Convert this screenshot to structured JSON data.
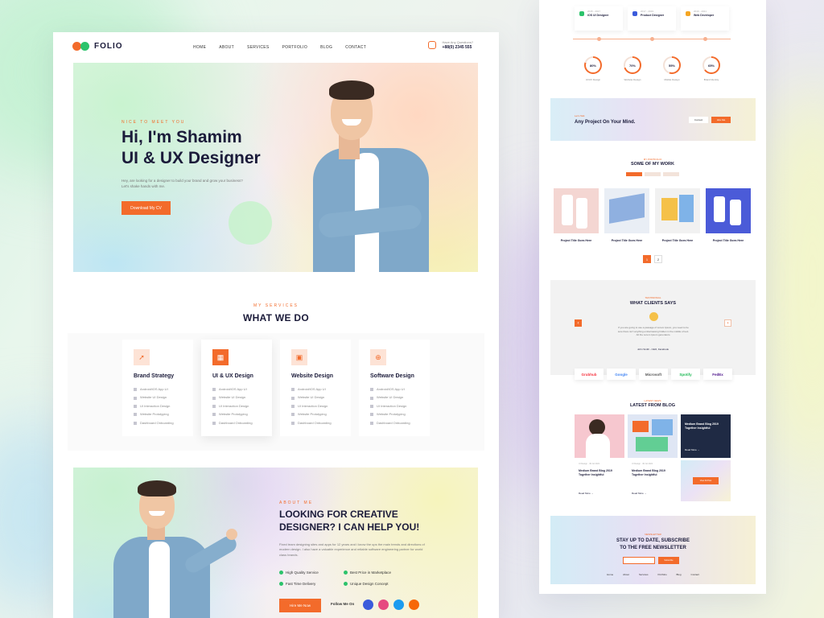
{
  "nav": {
    "logo": "FOLIO",
    "menu": [
      "HOME",
      "ABOUT",
      "SERVICES",
      "PORTFOLIO",
      "BLOG",
      "CONTACT"
    ],
    "phone_label": "Have Any Questions?",
    "phone_number": "+88(0) 2345 555"
  },
  "hero": {
    "subtitle": "NICE TO MEET YOU",
    "title_line1": "Hi, I'm Shamim",
    "title_line2": "UI & UX Designer",
    "description": "Hey, are looking for a designer to build your brand and grow your business? Let's shake hands with me.",
    "button": "Download My CV"
  },
  "services": {
    "subtitle": "MY SERVICES",
    "title": "WHAT WE DO",
    "items": [
      {
        "title": "Brand Strategy",
        "icon": "rocket-icon",
        "active": false,
        "features": [
          "Android/iOS App UI",
          "Website UI Design",
          "UI Interaction Design",
          "Website Prototyping",
          "Dashboard Onboarding"
        ]
      },
      {
        "title": "UI & UX Design",
        "icon": "layout-icon",
        "active": true,
        "features": [
          "Android/iOS App UI",
          "Website UI Design",
          "UI Interaction Design",
          "Website Prototyping",
          "Dashboard Onboarding"
        ]
      },
      {
        "title": "Website Design",
        "icon": "browser-icon",
        "active": false,
        "features": [
          "Android/iOS App UI",
          "Website UI Design",
          "UI Interaction Design",
          "Website Prototyping",
          "Dashboard Onboarding"
        ]
      },
      {
        "title": "Software Design",
        "icon": "globe-icon",
        "active": false,
        "features": [
          "Android/iOS App UI",
          "Website UI Design",
          "UI Interaction Design",
          "Website Prototyping",
          "Dashboard Onboarding"
        ]
      }
    ]
  },
  "about": {
    "subtitle": "ABOUT ME",
    "title_line1": "LOOKING FOR CREATIVE",
    "title_line2": "DESIGNER? I CAN HELP YOU!",
    "description": "Fixed team designing sites and apps for 12 years and i know the ups the main trends and directions of modern design. I also have a valuable experience and reliable software engineering partner for world class brands.",
    "features": [
      "High Quality Service",
      "Best Price in Marketplace",
      "Fast Time Delivery",
      "Unique Design Concept"
    ],
    "button": "Hire Me Now",
    "follow_label": "Follow Me On",
    "socials": [
      {
        "name": "facebook-icon",
        "color": "#3b5bdb"
      },
      {
        "name": "dribbble-icon",
        "color": "#e64980"
      },
      {
        "name": "twitter-icon",
        "color": "#1c9bef"
      },
      {
        "name": "instagram-icon",
        "color": "#f76707"
      }
    ]
  },
  "right": {
    "experience": [
      {
        "year": "2015 - 2017",
        "role": "iOS UI Designer",
        "color": "#2cc36b"
      },
      {
        "year": "2017 - 2019",
        "role": "Product Designer",
        "color": "#3b5bdb"
      },
      {
        "year": "2019 - 2021",
        "role": "Web Developer",
        "color": "#f5a623"
      }
    ],
    "skills": [
      {
        "pct": "80%",
        "label": "UI/UX Design",
        "value": 80
      },
      {
        "pct": "70%",
        "label": "Website Design",
        "value": 70
      },
      {
        "pct": "55%",
        "label": "Mobile Design",
        "value": 55
      },
      {
        "pct": "65%",
        "label": "Brand Identity",
        "value": 65
      }
    ],
    "cta": {
      "subtitle": "Let's Talk",
      "text": "Any Project On Your Mind.",
      "btn1": "Contact",
      "btn2": "Hire Me"
    },
    "work": {
      "subtitle": "MY PORTFOLIO",
      "title": "SOME OF MY WORK",
      "projects": [
        "Project Title Goes Here",
        "Project Title Goes Here",
        "Project Title Goes Here",
        "Project Title Goes Here"
      ],
      "pages": [
        "1",
        "2"
      ]
    },
    "testimonial": {
      "subtitle": "TESTIMONIAL",
      "title": "WHAT CLIENTS SAYS",
      "quote": "If you are going to use a passage of Lorem Ipsum, you need to be sure there isn't anything embarrassing hidden in the middle of text. All the Lorem Ipsum generators.",
      "name": "John Smith - CEO, Facebook"
    },
    "brands": [
      {
        "name": "Grubhub",
        "color": "#f63440"
      },
      {
        "name": "Google",
        "color": "#4285f4"
      },
      {
        "name": "Microsoft",
        "color": "#555555"
      },
      {
        "name": "Spotify",
        "color": "#1db954"
      },
      {
        "name": "FedEx",
        "color": "#4d148c"
      }
    ],
    "blog": {
      "subtitle": "LATEST NEWS",
      "title": "LATEST FROM BLOG",
      "posts": [
        {
          "tag": "UI Design  ·  30 Jul 2021",
          "title": "Medium Brand Blog 2019 Together Insightful",
          "more": "Read More →"
        },
        {
          "tag": "UI Design  ·  30 Jul 2021",
          "title": "Medium Brand Blog 2019 Together Insightful",
          "more": "Read More →"
        }
      ],
      "dark_title": "Medium Brand Blog 2019 Together Insightful",
      "dark_more": "Read More →",
      "view_all": "View All Post"
    },
    "newsletter": {
      "subtitle": "NEWSLETTER",
      "title_line1": "STAY UP TO DATE, SUBSCRIBE",
      "title_line2": "TO THE FREE NEWSLETTER",
      "button": "Subscribe",
      "menu": [
        "Home",
        "About",
        "Services",
        "Portfolio",
        "Blog",
        "Contact"
      ]
    }
  }
}
